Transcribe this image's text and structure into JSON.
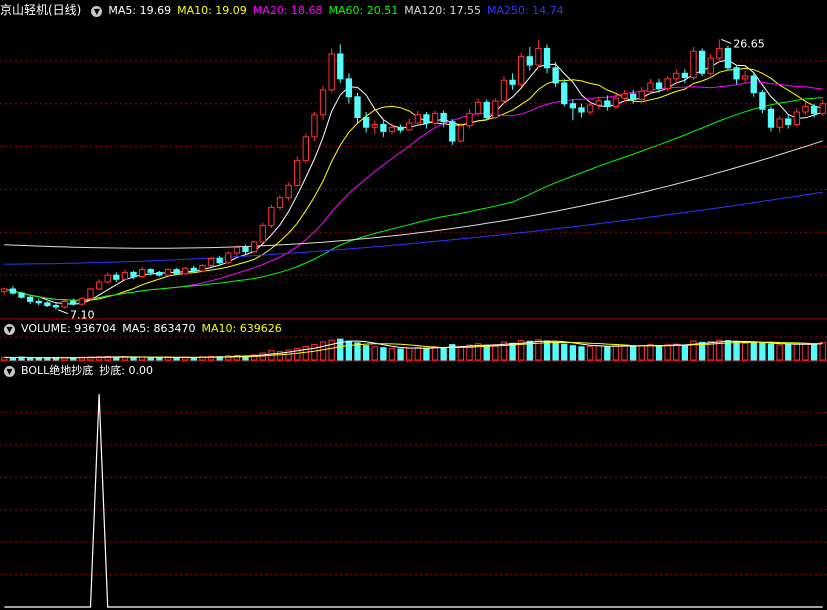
{
  "price_panel": {
    "stock_name": "京山轻机(日线)",
    "ma_items": [
      {
        "label": "MA5: 19.69",
        "color": "#ffffff"
      },
      {
        "label": "MA10: 19.09",
        "color": "#ffff00"
      },
      {
        "label": "MA20: 18.68",
        "color": "#ff00ff"
      },
      {
        "label": "MA60: 20.51",
        "color": "#00ff00"
      },
      {
        "label": "MA120: 17.55",
        "color": "#dddddd"
      },
      {
        "label": "MA250: 14.74",
        "color": "#3333ff"
      }
    ],
    "high_label": "26.65",
    "low_label": "7.10"
  },
  "volume_panel": {
    "label": "VOLUME: 936704",
    "ma5_label": "MA5: 863470",
    "ma10_label": "MA10: 639626"
  },
  "boll_panel": {
    "title": "BOLL绝地抄底",
    "value_label": "抄底: 0.00"
  },
  "colors": {
    "up": "#ff3232",
    "down": "#54fcfc",
    "grid": "#a00000",
    "divider": "#c00000"
  },
  "chart_data": {
    "type": "candlestick",
    "series_names": [
      "MA5",
      "MA10",
      "MA20",
      "MA60",
      "MA120",
      "MA250"
    ],
    "price_range": [
      6.5,
      28.2
    ],
    "high": 26.65,
    "low": 7.1,
    "candles": [
      [
        8.4,
        8.6,
        8.2,
        8.7
      ],
      [
        8.6,
        8.3,
        8.2,
        8.8
      ],
      [
        8.3,
        8.0,
        7.9,
        8.4
      ],
      [
        8.0,
        7.7,
        7.5,
        8.1
      ],
      [
        7.7,
        7.6,
        7.4,
        7.9
      ],
      [
        7.6,
        7.4,
        7.3,
        7.7
      ],
      [
        7.4,
        7.3,
        7.1,
        7.6
      ],
      [
        7.3,
        7.7,
        7.2,
        7.8
      ],
      [
        7.7,
        7.5,
        7.4,
        7.9
      ],
      [
        7.5,
        7.9,
        7.4,
        8.0
      ],
      [
        7.9,
        8.6,
        7.8,
        8.7
      ],
      [
        8.6,
        9.1,
        8.5,
        9.3
      ],
      [
        9.1,
        9.6,
        9.0,
        9.8
      ],
      [
        9.6,
        9.3,
        9.1,
        9.8
      ],
      [
        9.3,
        9.8,
        9.2,
        10.0
      ],
      [
        9.8,
        9.5,
        9.3,
        9.9
      ],
      [
        9.5,
        10.0,
        9.4,
        10.2
      ],
      [
        10.0,
        9.8,
        9.6,
        10.1
      ],
      [
        9.8,
        9.6,
        9.5,
        9.9
      ],
      [
        9.6,
        10.0,
        9.5,
        10.1
      ],
      [
        10.0,
        9.7,
        9.6,
        10.1
      ],
      [
        9.7,
        10.1,
        9.6,
        10.2
      ],
      [
        10.1,
        9.9,
        9.8,
        10.3
      ],
      [
        9.9,
        10.3,
        9.8,
        10.4
      ],
      [
        10.3,
        10.8,
        10.2,
        10.9
      ],
      [
        10.8,
        10.5,
        10.3,
        11.0
      ],
      [
        10.5,
        11.2,
        10.4,
        11.3
      ],
      [
        11.2,
        11.6,
        11.0,
        11.8
      ],
      [
        11.6,
        11.3,
        11.1,
        11.8
      ],
      [
        11.3,
        12.0,
        11.2,
        12.1
      ],
      [
        12.0,
        13.2,
        11.9,
        13.4
      ],
      [
        13.2,
        14.5,
        13.0,
        14.7
      ],
      [
        14.5,
        15.2,
        14.3,
        15.4
      ],
      [
        15.2,
        16.1,
        15.0,
        16.3
      ],
      [
        16.1,
        17.9,
        16.0,
        18.2
      ],
      [
        17.9,
        19.6,
        17.7,
        19.8
      ],
      [
        19.6,
        21.2,
        19.3,
        21.4
      ],
      [
        21.2,
        23.0,
        20.8,
        23.3
      ],
      [
        23.0,
        25.6,
        22.8,
        26.0
      ],
      [
        25.6,
        23.8,
        23.5,
        26.3
      ],
      [
        23.8,
        22.5,
        22.0,
        24.2
      ],
      [
        22.5,
        21.0,
        20.6,
        22.8
      ],
      [
        21.0,
        20.3,
        19.9,
        21.4
      ],
      [
        20.3,
        20.5,
        19.8,
        20.8
      ],
      [
        20.5,
        20.0,
        19.6,
        20.9
      ],
      [
        20.0,
        20.3,
        19.8,
        20.6
      ],
      [
        20.3,
        20.1,
        19.9,
        20.5
      ],
      [
        20.1,
        20.6,
        20.0,
        20.9
      ],
      [
        20.6,
        21.2,
        20.4,
        21.5
      ],
      [
        21.2,
        20.6,
        20.2,
        21.4
      ],
      [
        20.6,
        21.3,
        20.4,
        21.5
      ],
      [
        21.3,
        20.7,
        20.3,
        21.5
      ],
      [
        20.7,
        19.3,
        19.0,
        20.9
      ],
      [
        19.3,
        20.4,
        19.2,
        20.6
      ],
      [
        20.4,
        21.3,
        20.2,
        21.6
      ],
      [
        21.3,
        22.1,
        21.1,
        22.4
      ],
      [
        22.1,
        21.0,
        20.8,
        22.3
      ],
      [
        21.0,
        22.2,
        20.9,
        22.4
      ],
      [
        22.2,
        23.7,
        22.0,
        24.0
      ],
      [
        23.7,
        23.4,
        23.0,
        24.2
      ],
      [
        23.4,
        25.4,
        23.2,
        25.7
      ],
      [
        25.4,
        24.8,
        24.4,
        26.1
      ],
      [
        24.8,
        26.0,
        24.6,
        26.6
      ],
      [
        26.0,
        24.6,
        24.2,
        26.3
      ],
      [
        24.6,
        23.5,
        23.2,
        25.0
      ],
      [
        23.5,
        22.0,
        21.8,
        23.8
      ],
      [
        22.0,
        21.7,
        20.8,
        22.3
      ],
      [
        21.7,
        21.4,
        21.0,
        22.0
      ],
      [
        21.4,
        21.9,
        21.2,
        22.2
      ],
      [
        21.9,
        22.2,
        21.6,
        22.5
      ],
      [
        22.2,
        21.8,
        21.5,
        22.6
      ],
      [
        21.8,
        22.4,
        21.6,
        22.7
      ],
      [
        22.4,
        22.7,
        22.1,
        23.0
      ],
      [
        22.7,
        22.3,
        22.0,
        23.0
      ],
      [
        22.3,
        22.9,
        22.1,
        23.2
      ],
      [
        22.9,
        23.5,
        22.7,
        23.8
      ],
      [
        23.5,
        23.1,
        22.8,
        23.8
      ],
      [
        23.1,
        23.8,
        22.9,
        24.0
      ],
      [
        23.8,
        24.2,
        23.5,
        24.5
      ],
      [
        24.2,
        23.9,
        23.5,
        24.5
      ],
      [
        23.9,
        25.8,
        23.7,
        26.1
      ],
      [
        25.8,
        24.2,
        24.0,
        26.0
      ],
      [
        24.2,
        25.3,
        24.0,
        25.6
      ],
      [
        25.3,
        26.0,
        25.0,
        26.65
      ],
      [
        26.0,
        24.6,
        24.4,
        26.2
      ],
      [
        24.6,
        23.8,
        23.4,
        24.8
      ],
      [
        23.8,
        24.0,
        23.5,
        24.4
      ],
      [
        24.0,
        22.8,
        22.5,
        24.2
      ],
      [
        22.8,
        21.6,
        21.3,
        23.0
      ],
      [
        21.6,
        20.3,
        20.0,
        21.8
      ],
      [
        20.3,
        20.9,
        19.9,
        21.1
      ],
      [
        20.9,
        20.5,
        20.2,
        21.2
      ],
      [
        20.5,
        21.4,
        20.3,
        21.7
      ],
      [
        21.4,
        21.8,
        21.2,
        22.1
      ],
      [
        21.8,
        21.3,
        21.0,
        22.0
      ],
      [
        21.3,
        22.0,
        21.1,
        22.3
      ]
    ],
    "volume": [
      120,
      110,
      130,
      100,
      95,
      90,
      105,
      115,
      100,
      125,
      140,
      150,
      160,
      130,
      145,
      120,
      135,
      110,
      100,
      125,
      105,
      130,
      110,
      140,
      170,
      150,
      190,
      210,
      180,
      230,
      320,
      420,
      380,
      450,
      520,
      610,
      700,
      820,
      900,
      950,
      860,
      780,
      650,
      600,
      560,
      520,
      500,
      540,
      580,
      540,
      600,
      560,
      700,
      620,
      680,
      740,
      650,
      700,
      820,
      760,
      880,
      850,
      920,
      860,
      780,
      720,
      650,
      600,
      620,
      640,
      600,
      650,
      680,
      620,
      660,
      700,
      640,
      690,
      720,
      680,
      860,
      800,
      840,
      900,
      880,
      820,
      760,
      800,
      760,
      720,
      680,
      700,
      740,
      760,
      720,
      800
    ],
    "volume_max": 1000,
    "boll_signal": [
      0,
      0,
      0,
      0,
      0,
      0,
      0,
      0,
      0,
      0,
      0,
      1,
      0,
      0,
      0,
      0,
      0,
      0,
      0,
      0,
      0,
      0,
      0,
      0,
      0,
      0,
      0,
      0,
      0,
      0,
      0,
      0,
      0,
      0,
      0,
      0,
      0,
      0,
      0,
      0,
      0,
      0,
      0,
      0,
      0,
      0,
      0,
      0,
      0,
      0,
      0,
      0,
      0,
      0,
      0,
      0,
      0,
      0,
      0,
      0,
      0,
      0,
      0,
      0,
      0,
      0,
      0,
      0,
      0,
      0,
      0,
      0,
      0,
      0,
      0,
      0,
      0,
      0,
      0,
      0,
      0,
      0,
      0,
      0,
      0,
      0,
      0,
      0,
      0,
      0,
      0,
      0,
      0,
      0,
      0,
      0
    ],
    "grid": true
  }
}
